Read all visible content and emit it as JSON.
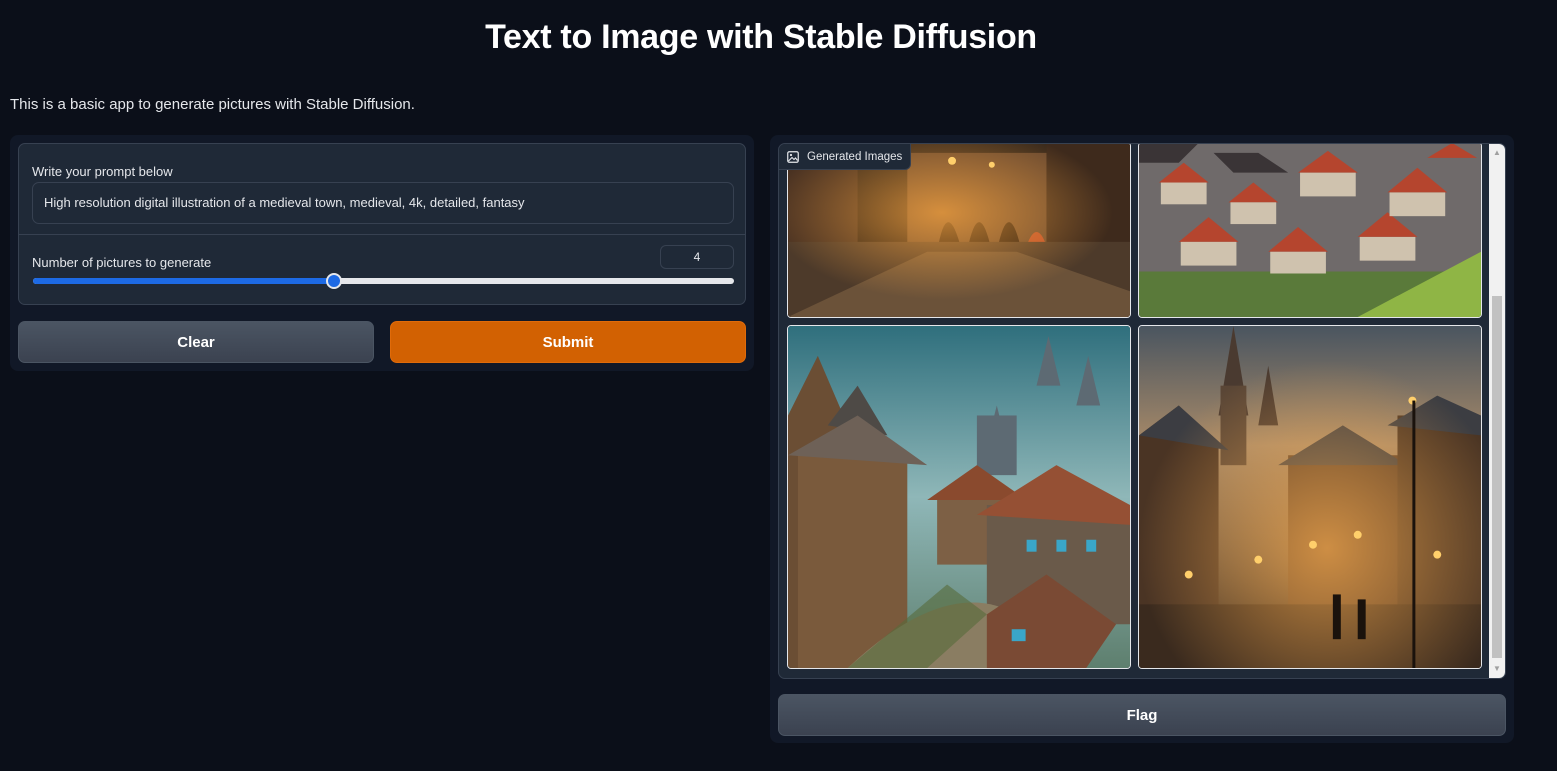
{
  "header": {
    "title": "Text to Image with Stable Diffusion",
    "description": "This is a basic app to generate pictures with Stable Diffusion."
  },
  "form": {
    "prompt_label": "Write your prompt below",
    "prompt_value": "High resolution digital illustration of a medieval town, medieval, 4k, detailed, fantasy",
    "slider_label": "Number of pictures to generate",
    "slider_value": "4",
    "slider_fraction": 0.43,
    "clear_label": "Clear",
    "submit_label": "Submit"
  },
  "gallery": {
    "label": "Generated Images",
    "label_icon": "image-icon",
    "images": [
      {
        "name": "generated-image-1"
      },
      {
        "name": "generated-image-2"
      },
      {
        "name": "generated-image-3"
      },
      {
        "name": "generated-image-4"
      }
    ]
  },
  "flag": {
    "label": "Flag"
  },
  "colors": {
    "background": "#0b0f19",
    "panel": "#111827",
    "block": "#1f2937",
    "border": "#374151",
    "primary": "#d26102",
    "slider": "#1d6ae5"
  }
}
